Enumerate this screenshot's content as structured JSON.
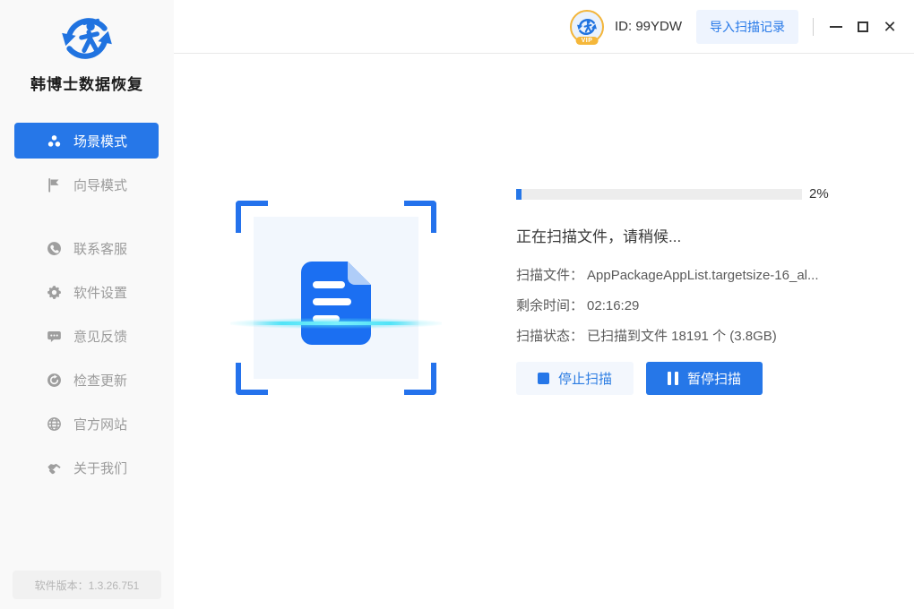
{
  "sidebar": {
    "app_title": "韩博士数据恢复",
    "items": [
      {
        "label": "场景模式",
        "icon": "scene-mode-icon",
        "active": true
      },
      {
        "label": "向导模式",
        "icon": "wizard-mode-icon",
        "active": false
      },
      {
        "label": "联系客服",
        "icon": "customer-service-icon",
        "active": false
      },
      {
        "label": "软件设置",
        "icon": "settings-icon",
        "active": false
      },
      {
        "label": "意见反馈",
        "icon": "feedback-icon",
        "active": false
      },
      {
        "label": "检查更新",
        "icon": "check-update-icon",
        "active": false
      },
      {
        "label": "官方网站",
        "icon": "official-website-icon",
        "active": false
      },
      {
        "label": "关于我们",
        "icon": "about-us-icon",
        "active": false
      }
    ],
    "version": "软件版本：1.3.26.751"
  },
  "topbar": {
    "user_id": "ID: 99YDW",
    "vip_badge": "VIP",
    "import_scan_records": "导入扫描记录"
  },
  "scan_panel": {
    "progress_value": 2,
    "progress_percent_label": "2%",
    "status_title": "正在扫描文件，请稍候...",
    "details": [
      {
        "label": "扫描文件：",
        "value": "AppPackageAppList.targetsize-16_al..."
      },
      {
        "label": "剩余时间：",
        "value": "02:16:29"
      },
      {
        "label": "扫描状态：",
        "value": "已扫描到文件 18191 个 (3.8GB)"
      }
    ],
    "stop_button": "停止扫描",
    "pause_button": "暂停扫描"
  },
  "colors": {
    "accent": "#2677E8",
    "scan_line": "#4DE3F7",
    "vip_gold": "#F5B73A",
    "sidebar_bg": "#F9F9F9",
    "doc_blue": "#1B6FF2"
  }
}
